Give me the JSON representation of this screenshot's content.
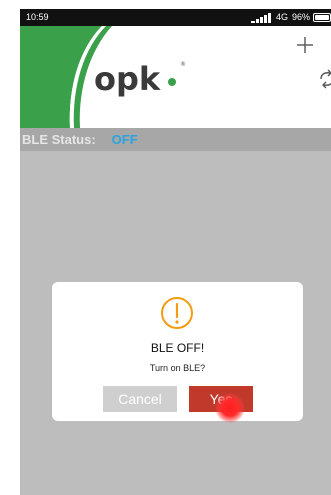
{
  "status_bar": {
    "time": "10:59",
    "network": "4G",
    "battery": "96%"
  },
  "header": {
    "logo_text": "opk",
    "add_icon": "plus-icon",
    "refresh_icon": "refresh-icon"
  },
  "ble_status": {
    "label": "BLE Status:",
    "value": "OFF"
  },
  "dialog": {
    "icon": "warning-icon",
    "title": "BLE OFF!",
    "message": "Turn on BLE?",
    "cancel_label": "Cancel",
    "yes_label": "Yes"
  },
  "colors": {
    "brand_green": "#3aa14a",
    "ble_value_blue": "#2ba3dc",
    "warning_orange": "#f39c12",
    "yes_red": "#c0392b"
  }
}
